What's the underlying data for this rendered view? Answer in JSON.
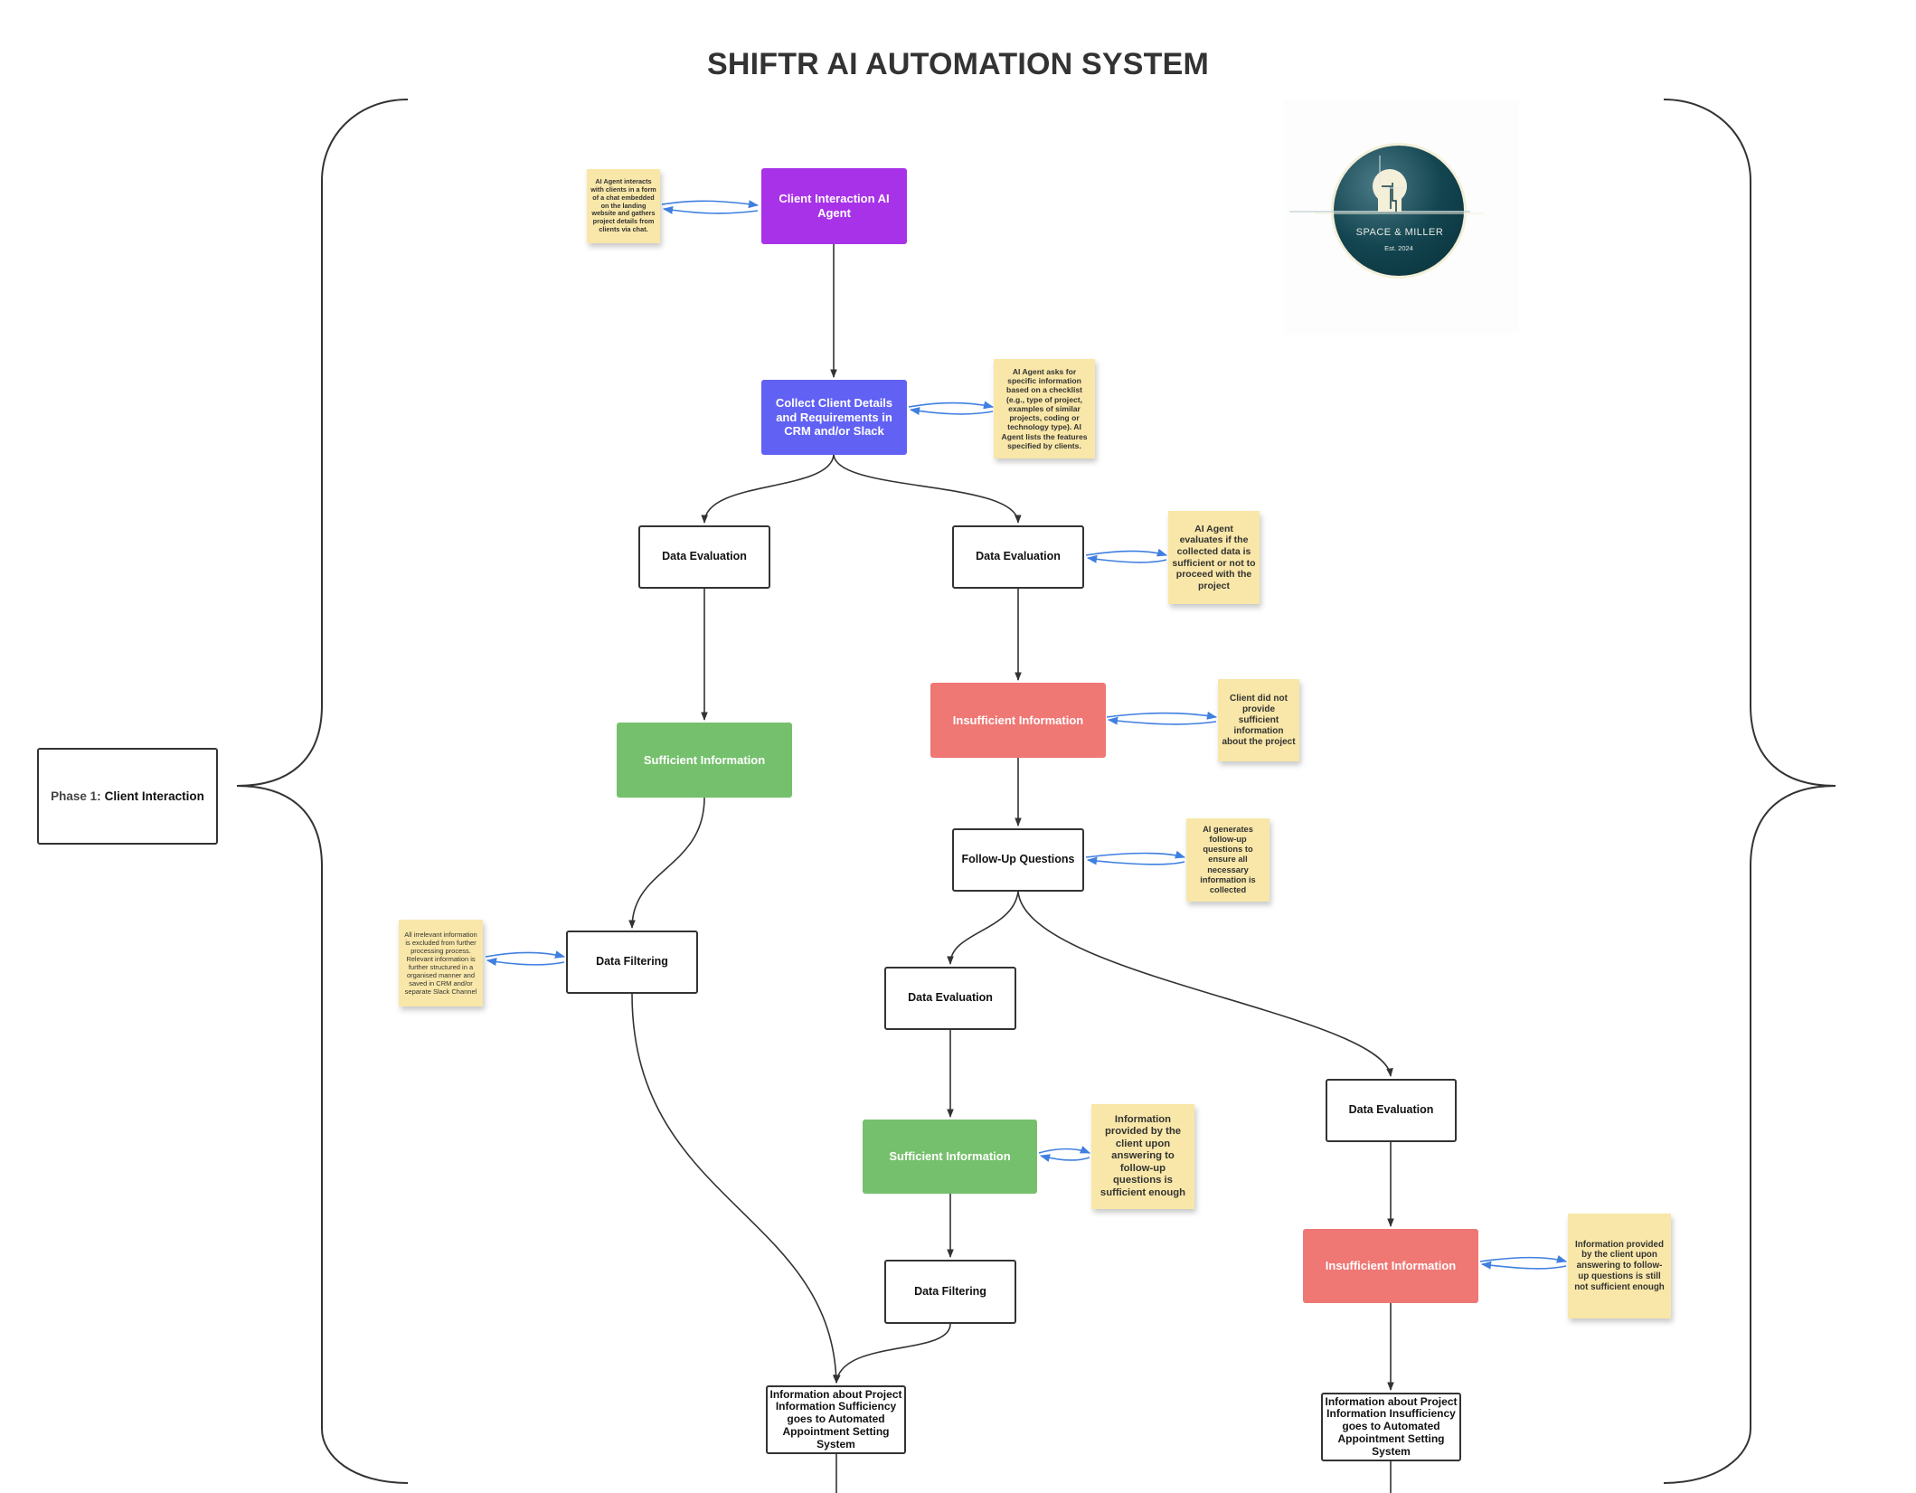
{
  "title": "SHIFTR AI AUTOMATION SYSTEM",
  "phase": {
    "prefix": "Phase 1:",
    "name": "Client Interaction"
  },
  "logo": {
    "brand": "SPACE & MILLER",
    "established": "Est. 2024",
    "colors": {
      "disc": "#0F3E46",
      "ring": "#F3EFD9"
    }
  },
  "colors": {
    "purple": "#A832E8",
    "blue": "#6161F4",
    "green": "#75C06C",
    "red": "#EF7774",
    "sticky": "#F8E7A8",
    "stroke": "#333333",
    "feedback": "#3F7FE0"
  },
  "nodes": {
    "client_agent": "Client Interaction AI Agent",
    "collect_details": "Collect Client Details and Requirements in CRM and/or Slack",
    "data_eval_left": "Data Evaluation",
    "data_eval_right": "Data Evaluation",
    "sufficient_left": "Sufficient Information",
    "insufficient_right": "Insufficient Information",
    "follow_up": "Follow-Up Questions",
    "data_filter_left": "Data Filtering",
    "data_eval_mid": "Data Evaluation",
    "data_eval_far_right": "Data Evaluation",
    "sufficient_mid": "Sufficient Information",
    "insufficient_far_right": "Insufficient Information",
    "data_filter_mid": "Data Filtering",
    "info_sufficiency": "Information about Project Information Sufficiency goes to Automated Appointment Setting System",
    "info_insufficiency": "Information about Project Information Insufficiency goes to Automated Appointment Setting System"
  },
  "notes": {
    "chat_agent": "AI Agent interacts with clients in a form of a chat embedded on the landing website and gathers project details from clients via chat.",
    "checklist": "AI Agent asks for specific information based on a checklist (e.g., type of project, examples of similar projects, coding or technology type). AI Agent lists the features specified by clients.",
    "evaluates": "AI Agent evaluates if the collected data is sufficient or not to proceed with the project",
    "not_provided": "Client did not provide sufficient information about the project",
    "follow_up": "AI generates follow-up questions to ensure all necessary information is collected",
    "filtering": "All irrelevant information is excluded from further processing process. Relevant information is further structured in a organised manner and saved in CRM and/or separate Slack Channel",
    "sufficient_after": "Information provided by the client upon answering to follow-up questions is sufficient enough",
    "insufficient_after": "Information provided by the client upon answering to follow-up questions is still not sufficient enough"
  }
}
